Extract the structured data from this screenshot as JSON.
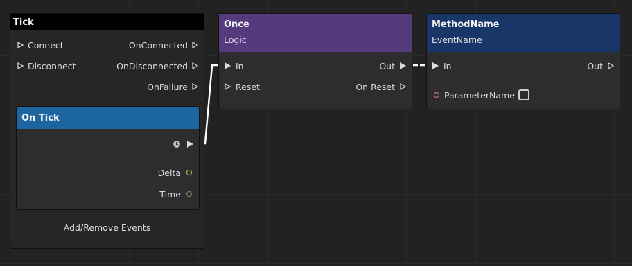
{
  "tick_node": {
    "title": "Tick",
    "inputs": [
      "Connect",
      "Disconnect"
    ],
    "outputs": [
      "OnConnected",
      "OnDisconnected",
      "OnFailure"
    ],
    "footer": "Add/Remove Events"
  },
  "on_tick_node": {
    "title": "On Tick",
    "outputs": [
      "Delta",
      "Time"
    ]
  },
  "once_node": {
    "title": "Once",
    "subtitle": "Logic",
    "inputs": [
      "In",
      "Reset"
    ],
    "outputs": [
      "Out",
      "On Reset"
    ]
  },
  "method_node": {
    "title": "MethodName",
    "subtitle": "EventName",
    "input": "In",
    "output": "Out",
    "parameter": "ParameterName"
  },
  "colors": {
    "background": "#222222",
    "node_body": "#2d2d30",
    "tick_header": "#000000",
    "on_tick_header": "#1d65a0",
    "once_header": "#553b7d",
    "method_header": "#183768",
    "delta_port": "#c6cc4a",
    "time_port": "#9a8a63",
    "param_port": "#d07a8a",
    "wire": "#ffffff"
  }
}
